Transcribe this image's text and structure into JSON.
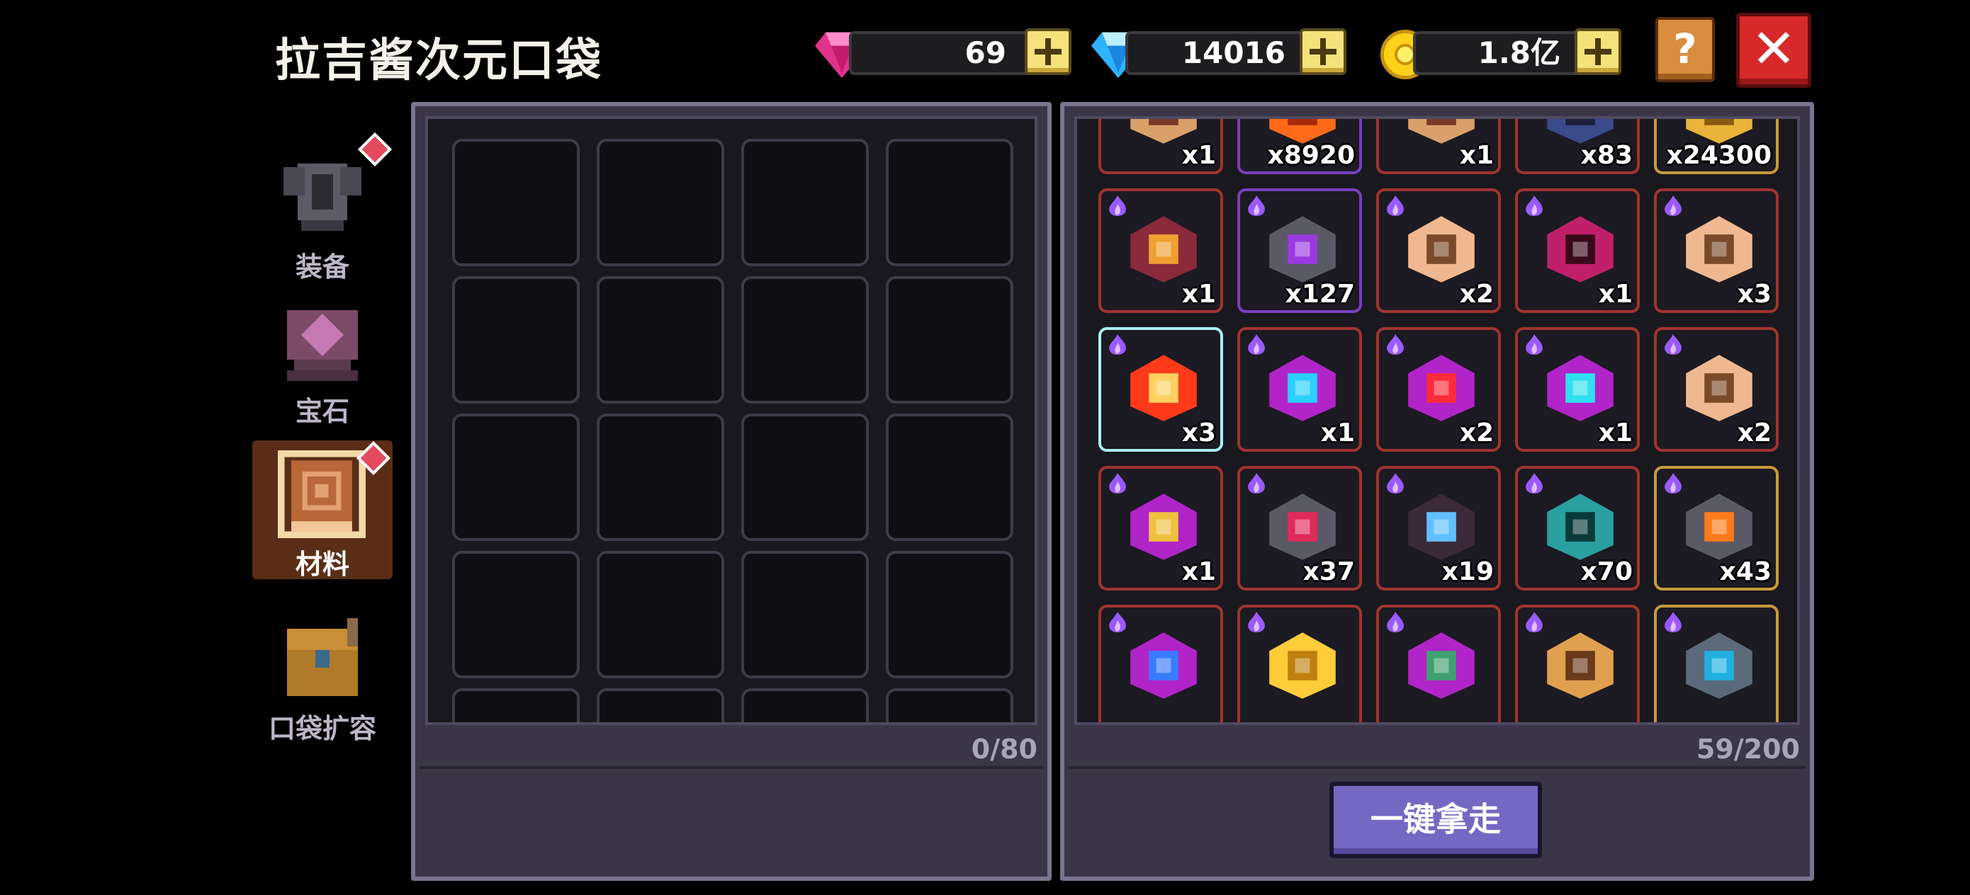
{
  "header": {
    "title": "拉吉酱次元口袋",
    "pink_gem_value": "69",
    "blue_gem_value": "14016",
    "coin_value": "1.8亿",
    "help_label": "?",
    "close_label": "✕"
  },
  "sidebar": {
    "items": [
      {
        "label": "装备",
        "icon": "armor-icon",
        "active": false,
        "badge": true
      },
      {
        "label": "宝石",
        "icon": "gem-stand-icon",
        "active": false,
        "badge": false
      },
      {
        "label": "材料",
        "icon": "material-book-icon",
        "active": true,
        "badge": true
      },
      {
        "label": "口袋扩容",
        "icon": "chest-icon",
        "active": false,
        "badge": false
      }
    ]
  },
  "left_panel": {
    "capacity": "0/80"
  },
  "right_panel": {
    "capacity": "59/200",
    "take_all_label": "一键拿走",
    "items": [
      {
        "qty": "x1",
        "icon": "portrait-card-icon",
        "rarity": "red"
      },
      {
        "qty": "x8920",
        "icon": "fire-crystal-icon",
        "rarity": "purple"
      },
      {
        "qty": "x1",
        "icon": "portrait-card-icon",
        "rarity": "red"
      },
      {
        "qty": "x83",
        "icon": "dark-blade-icon",
        "rarity": "red"
      },
      {
        "qty": "x24300",
        "icon": "gold-token-icon",
        "rarity": "gold"
      },
      {
        "qty": "x1",
        "icon": "rune-book-icon",
        "rarity": "red"
      },
      {
        "qty": "x127",
        "icon": "purple-gem-ore-icon",
        "rarity": "purple"
      },
      {
        "qty": "x2",
        "icon": "hero-portrait-icon",
        "rarity": "red"
      },
      {
        "qty": "x1",
        "icon": "mystery-cube-icon",
        "rarity": "red"
      },
      {
        "qty": "x3",
        "icon": "hero-portrait-icon",
        "rarity": "red"
      },
      {
        "qty": "x3",
        "icon": "red-crystal-icon",
        "rarity": "selected"
      },
      {
        "qty": "x1",
        "icon": "blue-rune-cube-icon",
        "rarity": "red"
      },
      {
        "qty": "x2",
        "icon": "red-rune-cube-icon",
        "rarity": "red"
      },
      {
        "qty": "x1",
        "icon": "cyan-rune-cube-icon",
        "rarity": "red"
      },
      {
        "qty": "x2",
        "icon": "hero-portrait-icon",
        "rarity": "red"
      },
      {
        "qty": "x1",
        "icon": "gold-rune-cube-icon",
        "rarity": "red"
      },
      {
        "qty": "x37",
        "icon": "red-gem-ore-icon",
        "rarity": "red"
      },
      {
        "qty": "x19",
        "icon": "shadow-card-icon",
        "rarity": "red"
      },
      {
        "qty": "x70",
        "icon": "teal-blade-icon",
        "rarity": "red"
      },
      {
        "qty": "x43",
        "icon": "orange-gem-ore-icon",
        "rarity": "gold"
      },
      {
        "qty": "",
        "icon": "heart-rune-cube-icon",
        "rarity": "red"
      },
      {
        "qty": "",
        "icon": "gold-shard-icon",
        "rarity": "red"
      },
      {
        "qty": "",
        "icon": "green-rune-cube-icon",
        "rarity": "red"
      },
      {
        "qty": "",
        "icon": "golden-figure-icon",
        "rarity": "red"
      },
      {
        "qty": "",
        "icon": "spiral-stone-icon",
        "rarity": "gold"
      }
    ]
  }
}
